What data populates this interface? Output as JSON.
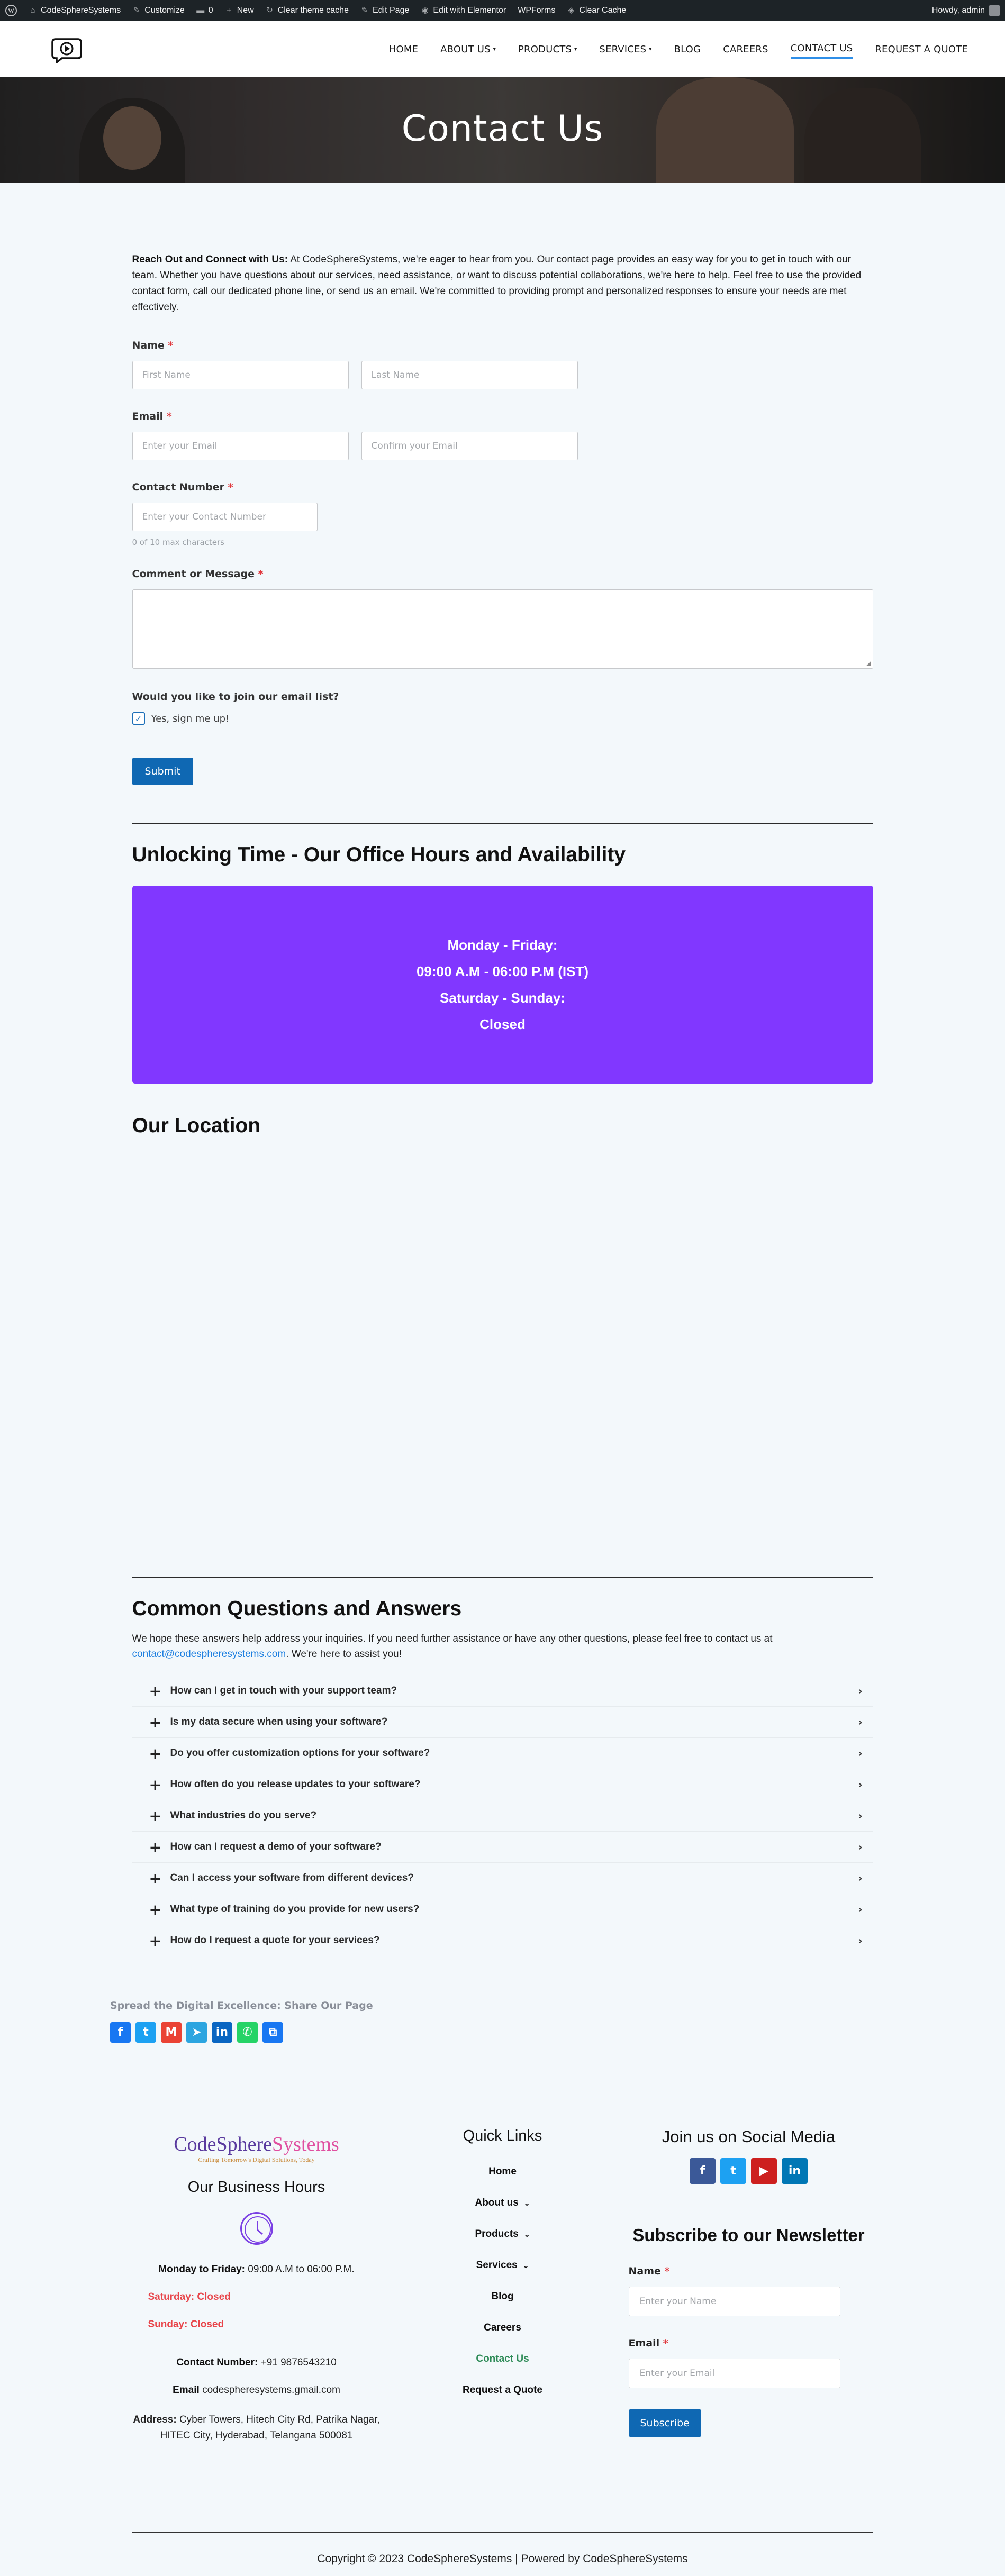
{
  "admin_bar": {
    "site_name": "CodeSphereSystems",
    "customize": "Customize",
    "comments_count": "0",
    "new": "New",
    "clear_theme_cache": "Clear theme cache",
    "edit_page": "Edit Page",
    "edit_elementor": "Edit with Elementor",
    "wpforms": "WPForms",
    "clear_cache": "Clear Cache",
    "howdy": "Howdy, admin"
  },
  "nav": {
    "items": [
      {
        "label": "HOME",
        "dropdown": false
      },
      {
        "label": "ABOUT US",
        "dropdown": true
      },
      {
        "label": "PRODUCTS",
        "dropdown": true
      },
      {
        "label": "SERVICES",
        "dropdown": true
      },
      {
        "label": "BLOG",
        "dropdown": false
      },
      {
        "label": "CAREERS",
        "dropdown": false
      },
      {
        "label": "CONTACT US",
        "dropdown": false,
        "active": true
      },
      {
        "label": "REQUEST A QUOTE",
        "dropdown": false
      }
    ]
  },
  "hero": {
    "title": "Contact Us"
  },
  "intro": {
    "bold": "Reach Out and Connect with Us:",
    "text": " At CodeSphereSystems, we're eager to hear from you. Our contact page provides an easy way for you to get in touch with our team. Whether you have questions about our services, need assistance, or want to discuss potential collaborations, we're here to help. Feel free to use the provided contact form, call our dedicated phone line, or send us an email. We're committed to providing prompt and personalized responses to ensure your needs are met effectively."
  },
  "form": {
    "name_label": "Name",
    "first_name_placeholder": "First Name",
    "last_name_placeholder": "Last Name",
    "email_label": "Email",
    "email_placeholder": "Enter your Email",
    "confirm_email_placeholder": "Confirm your Email",
    "contact_label": "Contact Number",
    "contact_placeholder": "Enter your Contact Number",
    "contact_limit": "0 of 10 max characters",
    "message_label": "Comment or Message",
    "required_mark": "*",
    "newsletter_question": "Would you like to join our email list?",
    "newsletter_option": "Yes, sign me up!",
    "newsletter_checked": true,
    "submit": "Submit"
  },
  "office": {
    "title": "Unlocking Time - Our Office Hours and Availability",
    "lines": [
      "Monday - Friday:",
      "09:00 A.M - 06:00 P.M (IST)",
      "Saturday - Sunday:",
      "Closed"
    ],
    "bg_color": "#8137ff"
  },
  "location": {
    "title": "Our Location"
  },
  "faq": {
    "title": "Common Questions and Answers",
    "intro_text": "We hope these answers help address your inquiries. If you need further assistance or have any other questions, please feel free to contact us at ",
    "email_link": "contact@codespheresystems.com",
    "intro_end": ". We're here to assist you!",
    "items": [
      "How can I get in touch with your support team?",
      "Is my data secure when using your software?",
      "Do you offer customization options for your software?",
      "How often do you release updates to your software?",
      "What industries do you serve?",
      "How can I request a demo of your software?",
      "Can I access your software from different devices?",
      "What type of training do you provide for new users?",
      "How do I request a quote for your services?"
    ]
  },
  "share": {
    "title": "Spread the Digital Excellence: Share Our Page",
    "icons": [
      {
        "name": "facebook-icon",
        "glyph": "f",
        "color": "#1877f2"
      },
      {
        "name": "twitter-icon",
        "glyph": "t",
        "color": "#1da1f2"
      },
      {
        "name": "gmail-icon",
        "glyph": "M",
        "color": "#ea4335"
      },
      {
        "name": "telegram-icon",
        "glyph": "➤",
        "color": "#2ca5e0"
      },
      {
        "name": "linkedin-icon",
        "glyph": "in",
        "color": "#0a66c2"
      },
      {
        "name": "whatsapp-icon",
        "glyph": "✆",
        "color": "#25d366"
      },
      {
        "name": "copy-link-icon",
        "glyph": "⧉",
        "color": "#1877f2"
      }
    ]
  },
  "footer": {
    "brand_first": "CodeSphere",
    "brand_second": "Systems",
    "tagline": "Crafting Tomorrow's Digital Solutions, Today",
    "hours_title": "Our Business Hours",
    "weekday_label": "Monday to Friday:",
    "weekday_hours": " 09:00 A.M to 06:00 P.M.",
    "saturday": "Saturday: Closed",
    "sunday": "Sunday: Closed",
    "contact_label": "Contact Number:",
    "contact_value": " +91 9876543210",
    "email_label": "Email",
    "email_value": " codespheresystems.gmail.com",
    "address_label": "Address:",
    "address_value": " Cyber Towers, Hitech City Rd, Patrika Nagar, HITEC City, Hyderabad, Telangana 500081",
    "quick_links_title": "Quick Links",
    "quick_links": [
      {
        "label": "Home",
        "dropdown": false
      },
      {
        "label": "About us",
        "dropdown": true
      },
      {
        "label": "Products",
        "dropdown": true
      },
      {
        "label": "Services",
        "dropdown": true
      },
      {
        "label": "Blog",
        "dropdown": false
      },
      {
        "label": "Careers",
        "dropdown": false
      },
      {
        "label": "Contact Us",
        "dropdown": false,
        "active": true
      },
      {
        "label": "Request a Quote",
        "dropdown": false
      }
    ],
    "social_title": "Join us on Social Media",
    "social_icons": [
      {
        "name": "facebook-icon",
        "glyph": "f",
        "color": "#3b5998"
      },
      {
        "name": "twitter-icon",
        "glyph": "t",
        "color": "#1da1f2"
      },
      {
        "name": "youtube-icon",
        "glyph": "▶",
        "color": "#cd201f"
      },
      {
        "name": "linkedin-icon",
        "glyph": "in",
        "color": "#0077b5"
      }
    ],
    "subscribe_title": "Subscribe to our Newsletter",
    "name_label": "Name",
    "name_placeholder": "Enter your Name",
    "email_placeholder": "Enter your Email",
    "subscribe_button": "Subscribe"
  },
  "copyright": "Copyright © 2023 CodeSphereSystems | Powered by CodeSphereSystems"
}
